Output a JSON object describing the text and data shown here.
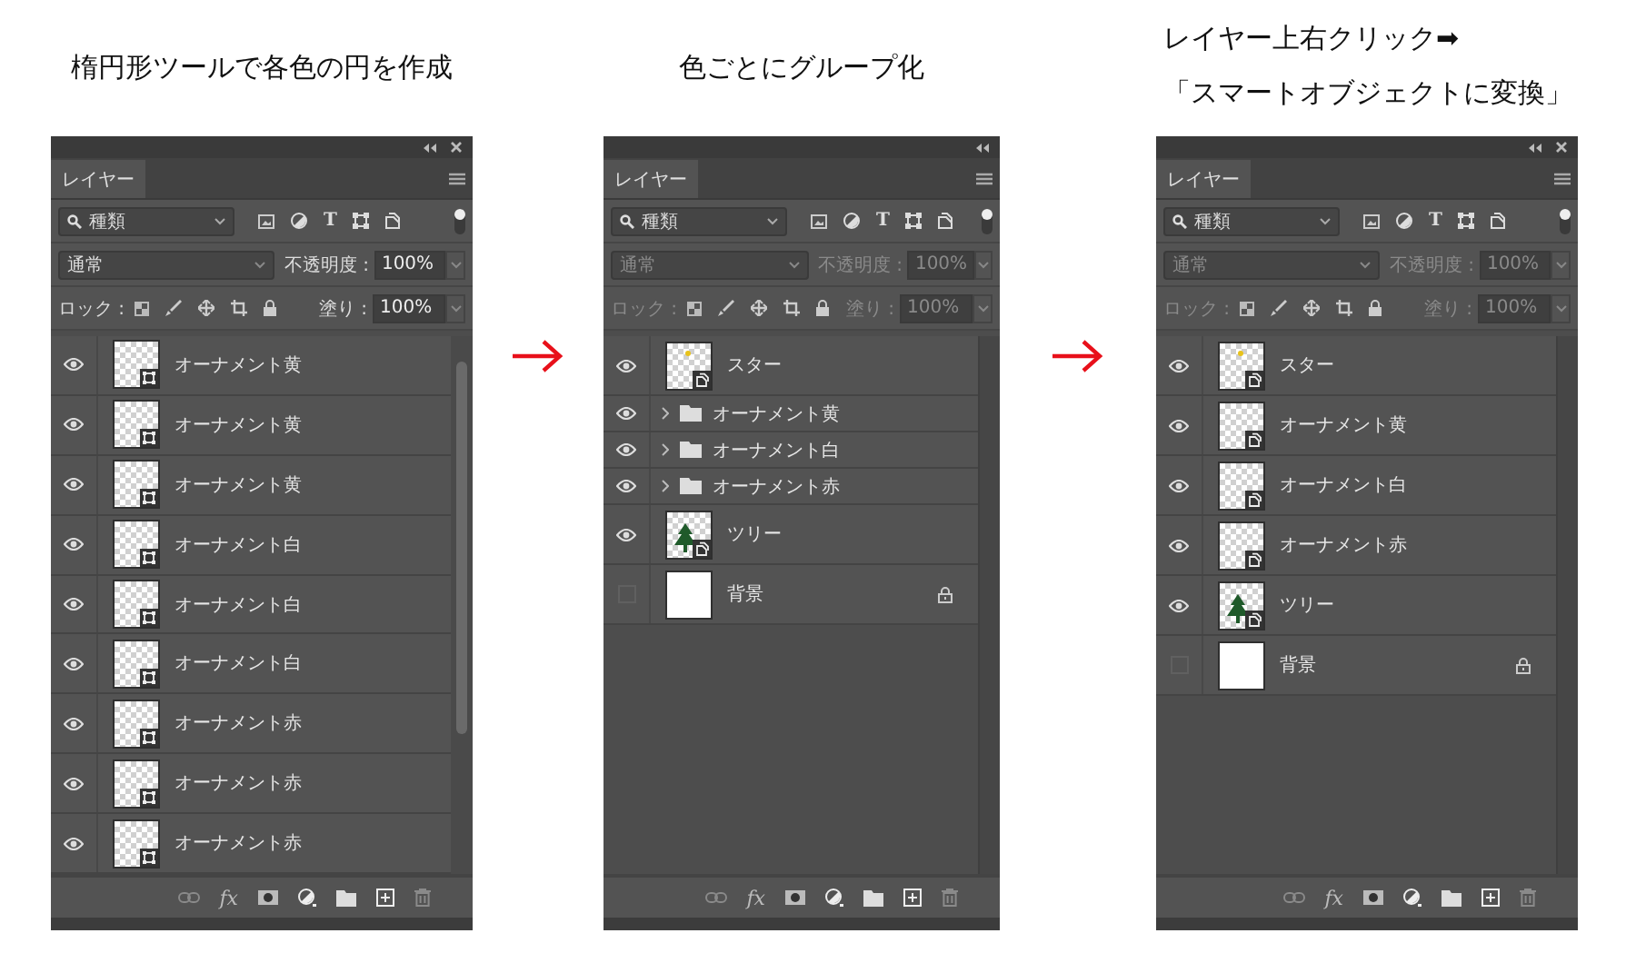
{
  "steps": [
    {
      "caption": [
        "楕円形ツールで各色の円を作成"
      ],
      "panel": {
        "tab": "レイヤー",
        "close_button": true,
        "filter": "種類",
        "type_filter": "T",
        "blend_mode": "通常",
        "opacity_label": "不透明度 :",
        "opacity": "100%",
        "lock_label": "ロック :",
        "fill_label": "塗り :",
        "fill": "100%",
        "blending_disabled": false,
        "scrollable": true,
        "fx": "fx",
        "layers": [
          {
            "name": "オーナメント黄",
            "kind": "shape",
            "visible": true,
            "thumbnail": {
              "kind": "transparent"
            },
            "locked": false
          },
          {
            "name": "オーナメント黄",
            "kind": "shape",
            "visible": true,
            "thumbnail": {
              "kind": "transparent"
            },
            "locked": false
          },
          {
            "name": "オーナメント黄",
            "kind": "shape",
            "visible": true,
            "thumbnail": {
              "kind": "transparent"
            },
            "locked": false
          },
          {
            "name": "オーナメント白",
            "kind": "shape",
            "visible": true,
            "thumbnail": {
              "kind": "transparent"
            },
            "locked": false
          },
          {
            "name": "オーナメント白",
            "kind": "shape",
            "visible": true,
            "thumbnail": {
              "kind": "transparent"
            },
            "locked": false
          },
          {
            "name": "オーナメント白",
            "kind": "shape",
            "visible": true,
            "thumbnail": {
              "kind": "transparent"
            },
            "locked": false
          },
          {
            "name": "オーナメント赤",
            "kind": "shape",
            "visible": true,
            "thumbnail": {
              "kind": "transparent"
            },
            "locked": false
          },
          {
            "name": "オーナメント赤",
            "kind": "shape",
            "visible": true,
            "thumbnail": {
              "kind": "transparent"
            },
            "locked": false
          },
          {
            "name": "オーナメント赤",
            "kind": "shape",
            "visible": true,
            "thumbnail": {
              "kind": "transparent"
            },
            "locked": false
          }
        ]
      }
    },
    {
      "caption": [
        "色ごとにグループ化"
      ],
      "panel": {
        "tab": "レイヤー",
        "close_button": false,
        "filter": "種類",
        "type_filter": "T",
        "blend_mode": "通常",
        "opacity_label": "不透明度 :",
        "opacity": "100%",
        "lock_label": "ロック :",
        "fill_label": "塗り :",
        "fill": "100%",
        "blending_disabled": true,
        "scrollable": false,
        "fx": "fx",
        "layers": [
          {
            "name": "スター",
            "kind": "smart",
            "visible": true,
            "thumbnail": {
              "kind": "star"
            },
            "locked": false
          },
          {
            "name": "オーナメント黄",
            "kind": "group",
            "visible": true,
            "expanded": false,
            "locked": false
          },
          {
            "name": "オーナメント白",
            "kind": "group",
            "visible": true,
            "expanded": false,
            "locked": false
          },
          {
            "name": "オーナメント赤",
            "kind": "group",
            "visible": true,
            "expanded": false,
            "locked": false
          },
          {
            "name": "ツリー",
            "kind": "smart",
            "visible": true,
            "thumbnail": {
              "kind": "tree"
            },
            "locked": false
          },
          {
            "name": "背景",
            "kind": "background",
            "visible": false,
            "thumbnail": {
              "kind": "white"
            },
            "locked": true
          }
        ]
      }
    },
    {
      "caption": [
        "レイヤー上右クリック➡",
        "「スマートオブジェクトに変換」"
      ],
      "panel": {
        "tab": "レイヤー",
        "close_button": true,
        "filter": "種類",
        "type_filter": "T",
        "blend_mode": "通常",
        "opacity_label": "不透明度 :",
        "opacity": "100%",
        "lock_label": "ロック :",
        "fill_label": "塗り :",
        "fill": "100%",
        "blending_disabled": true,
        "scrollable": false,
        "fx": "fx",
        "layers": [
          {
            "name": "スター",
            "kind": "smart",
            "visible": true,
            "thumbnail": {
              "kind": "star"
            },
            "locked": false
          },
          {
            "name": "オーナメント黄",
            "kind": "smart",
            "visible": true,
            "thumbnail": {
              "kind": "transparent"
            },
            "locked": false
          },
          {
            "name": "オーナメント白",
            "kind": "smart",
            "visible": true,
            "thumbnail": {
              "kind": "transparent"
            },
            "locked": false
          },
          {
            "name": "オーナメント赤",
            "kind": "smart",
            "visible": true,
            "thumbnail": {
              "kind": "transparent"
            },
            "locked": false
          },
          {
            "name": "ツリー",
            "kind": "smart",
            "visible": true,
            "thumbnail": {
              "kind": "tree"
            },
            "locked": false
          },
          {
            "name": "背景",
            "kind": "background",
            "visible": false,
            "thumbnail": {
              "kind": "white"
            },
            "locked": true
          }
        ]
      }
    }
  ]
}
